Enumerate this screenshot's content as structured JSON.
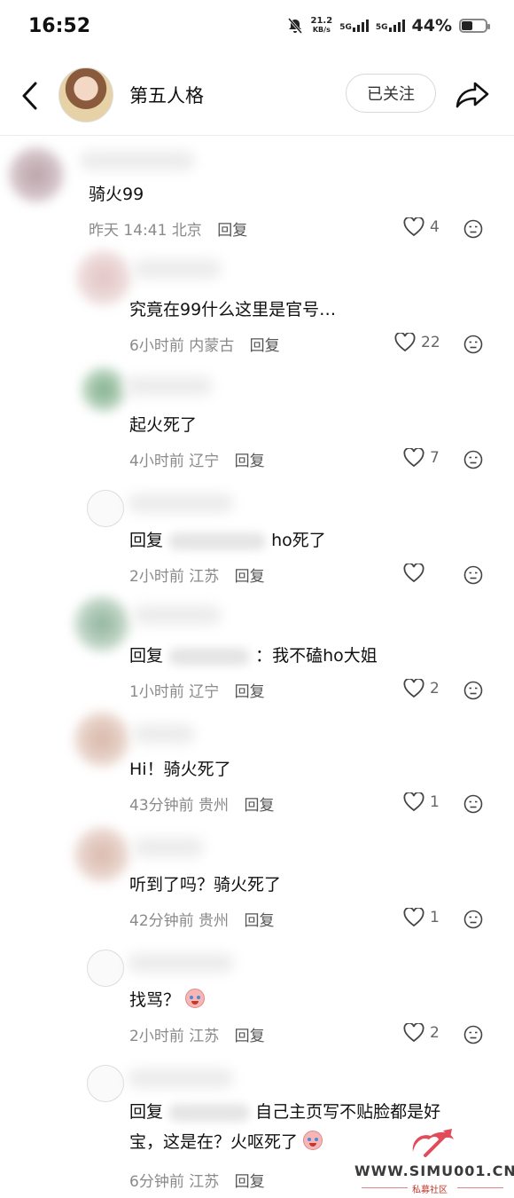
{
  "status_bar": {
    "time": "16:52",
    "speed_value": "21.2",
    "speed_unit": "KB/s",
    "net1": "5G",
    "net2": "5G",
    "battery": "44%"
  },
  "header": {
    "title": "第五人格",
    "follow_label": "已关注"
  },
  "reply_label": "回复",
  "comments": [
    {
      "text": "骑火99",
      "time": "昨天 14:41",
      "location": "北京",
      "likes": "4"
    },
    {
      "text": "究竟在99什么这里是官号…",
      "time": "6小时前",
      "location": "内蒙古",
      "likes": "22"
    },
    {
      "text": "起火死了",
      "time": "4小时前",
      "location": "辽宁",
      "likes": "7"
    },
    {
      "text_prefix": "回复",
      "text_suffix": "ho死了",
      "time": "2小时前",
      "location": "江苏",
      "likes": ""
    },
    {
      "text_prefix": "回复",
      "text_suffix": "：我不磕ho大姐",
      "time": "1小时前",
      "location": "辽宁",
      "likes": "2"
    },
    {
      "text": "Hi！骑火死了",
      "time": "43分钟前",
      "location": "贵州",
      "likes": "1"
    },
    {
      "text": "听到了吗？骑火死了",
      "time": "42分钟前",
      "location": "贵州",
      "likes": "1"
    },
    {
      "text": "找骂？",
      "time": "2小时前",
      "location": "江苏",
      "likes": "2"
    },
    {
      "text_prefix": "回复",
      "text_suffix": "自己主页写不贴脸都是好",
      "text_line2": "宝，这是在？火呕死了",
      "time": "6分钟前",
      "location": "江苏",
      "likes": ""
    }
  ],
  "watermark": {
    "url": "WWW.SIMU001.CN",
    "sub": "私募社区"
  },
  "icons": [
    "back-arrow-icon",
    "share-icon",
    "heart-icon",
    "dislike-face-icon",
    "mute-bell-icon",
    "crying-emoji-icon"
  ]
}
